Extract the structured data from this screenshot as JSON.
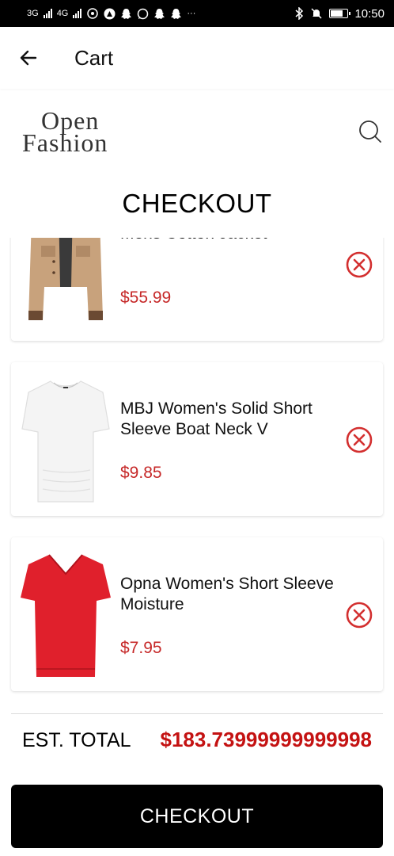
{
  "status_bar": {
    "network_left": "3G",
    "network_right": "4G",
    "time": "10:50",
    "notification_icons": [
      "hotspot-icon",
      "app-icon",
      "snapchat-icon",
      "whatsapp-icon",
      "snapchat-icon",
      "snapchat-icon"
    ],
    "more": "···",
    "battery_level": 0.75
  },
  "app_bar": {
    "title": "Cart"
  },
  "header": {
    "brand_line1": "Open",
    "brand_line2": "Fashion",
    "heading": "CHECKOUT"
  },
  "cart": {
    "items": [
      {
        "name": "Mens Cotton Jacket",
        "price": "$55.99",
        "image": "jacket"
      },
      {
        "name": "MBJ Women's Solid Short Sleeve Boat Neck V",
        "price": "$9.85",
        "image": "white-top"
      },
      {
        "name": "Opna Women's Short Sleeve Moisture",
        "price": "$7.95",
        "image": "red-shirt"
      }
    ]
  },
  "total": {
    "label": "EST. TOTAL",
    "value": "$183.73999999999998"
  },
  "checkout_button": {
    "label": "CHECKOUT"
  },
  "colors": {
    "accent": "#c62828",
    "total": "#c41212",
    "button_bg": "#000000"
  }
}
